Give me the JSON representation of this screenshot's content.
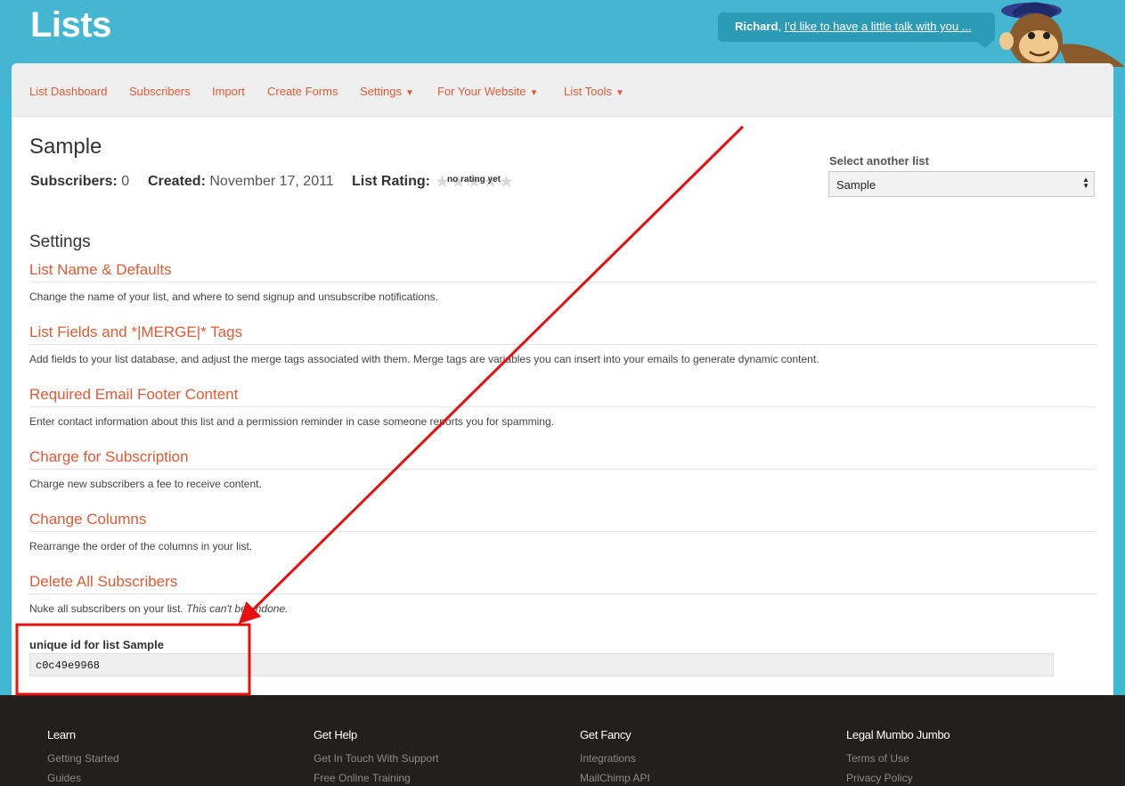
{
  "header": {
    "app_title": "Lists",
    "talk": {
      "name": "Richard",
      "separator": ", ",
      "link": "I'd like to have a little talk with you ..."
    }
  },
  "nav": {
    "items": [
      {
        "label": "List Dashboard",
        "caret": ""
      },
      {
        "label": "Subscribers",
        "caret": ""
      },
      {
        "label": "Import",
        "caret": ""
      },
      {
        "label": "Create Forms",
        "caret": ""
      },
      {
        "label": "Settings",
        "caret": "▼"
      },
      {
        "label": "For Your Website",
        "caret": "▼"
      },
      {
        "label": "List Tools",
        "caret": "▼"
      }
    ]
  },
  "list": {
    "title": "Sample",
    "subscribers_label": "Subscribers:",
    "subscribers_value": "0",
    "created_label": "Created:",
    "created_value": "November 17, 2011",
    "rating_label": "List Rating:",
    "rating_text": "no rating yet",
    "rating_stars": 0
  },
  "selector": {
    "label": "Select another list",
    "value": "Sample"
  },
  "settings": {
    "heading": "Settings",
    "items": [
      {
        "title": "List Name & Defaults",
        "desc": "Change the name of your list, and where to send signup and unsubscribe notifications.",
        "desc_em": ""
      },
      {
        "title": "List Fields and *|MERGE|* Tags",
        "desc": "Add fields to your list database, and adjust the merge tags associated with them. Merge tags are variables you can insert into your emails to generate dynamic content.",
        "desc_em": ""
      },
      {
        "title": "Required Email Footer Content",
        "desc": "Enter contact information about this list and a permission reminder in case someone reports you for spamming.",
        "desc_em": ""
      },
      {
        "title": "Charge for Subscription",
        "desc": "Charge new subscribers a fee to receive content.",
        "desc_em": ""
      },
      {
        "title": "Change Columns",
        "desc": "Rearrange the order of the columns in your list.",
        "desc_em": ""
      },
      {
        "title": "Delete All Subscribers",
        "desc": "Nuke all subscribers on your list. ",
        "desc_em": "This can't be undone."
      }
    ]
  },
  "unique_id": {
    "label": "unique id for list Sample",
    "value": "c0c49e9968"
  },
  "annotation": {
    "color": "#e8100f"
  },
  "footer": {
    "columns": [
      {
        "heading": "Learn",
        "links": [
          "Getting Started",
          "Guides"
        ]
      },
      {
        "heading": "Get Help",
        "links": [
          "Get In Touch With Support",
          "Free Online Training"
        ]
      },
      {
        "heading": "Get Fancy",
        "links": [
          "Integrations",
          "MailChimp API"
        ]
      },
      {
        "heading": "Legal Mumbo Jumbo",
        "links": [
          "Terms of Use",
          "Privacy Policy"
        ]
      }
    ]
  },
  "colors": {
    "header_bg": "#45b6d2",
    "accent_link": "#e25a33",
    "footer_bg": "#221f1c"
  }
}
